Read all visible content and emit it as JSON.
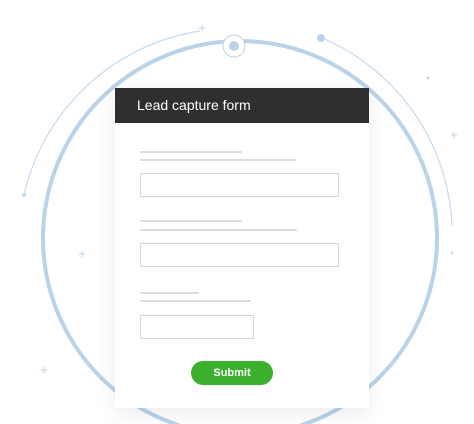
{
  "form": {
    "title": "Lead capture form",
    "submit_label": "Submit"
  },
  "colors": {
    "header_bg": "#2f2f2f",
    "submit_bg": "#3bb02e",
    "decoration_arc": "#b9d3e8"
  },
  "icons": [
    "sparkle-icon",
    "orbit-dot-icon",
    "target-ring-icon"
  ]
}
